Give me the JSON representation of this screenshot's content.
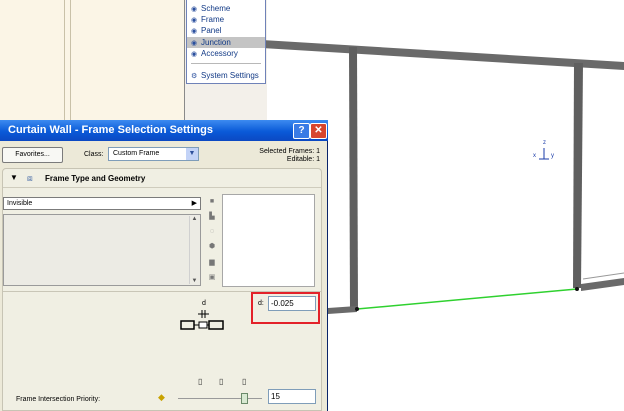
{
  "palette": {
    "items": [
      {
        "label": "Scheme",
        "icon": "eye-icon"
      },
      {
        "label": "Frame",
        "icon": "eye-icon"
      },
      {
        "label": "Panel",
        "icon": "eye-icon"
      },
      {
        "label": "Junction",
        "icon": "eye-icon",
        "selected": true
      },
      {
        "label": "Accessory",
        "icon": "eye-icon"
      }
    ],
    "system_settings": "System Settings"
  },
  "axes": {
    "z": "z",
    "x": "x",
    "y": "y"
  },
  "dialog": {
    "title": "Curtain Wall - Frame Selection Settings",
    "help_label": "?",
    "close_label": "✕",
    "favorites_label": "Favorites...",
    "class_label": "Class:",
    "class_value": "Custom Frame",
    "selected_frames": "Selected Frames: 1",
    "editable": "Editable: 1",
    "section_title": "Frame Type and Geometry",
    "type_value": "Invisible",
    "d_symbol": "d",
    "d_label": "d:",
    "d_value": "-0.025",
    "priority_label": "Frame Intersection Priority:",
    "priority_value": "15"
  },
  "colors": {
    "title_bar": "#0a5ad8",
    "highlight_box": "#e3222a",
    "selected_edge": "#2fd12f"
  }
}
